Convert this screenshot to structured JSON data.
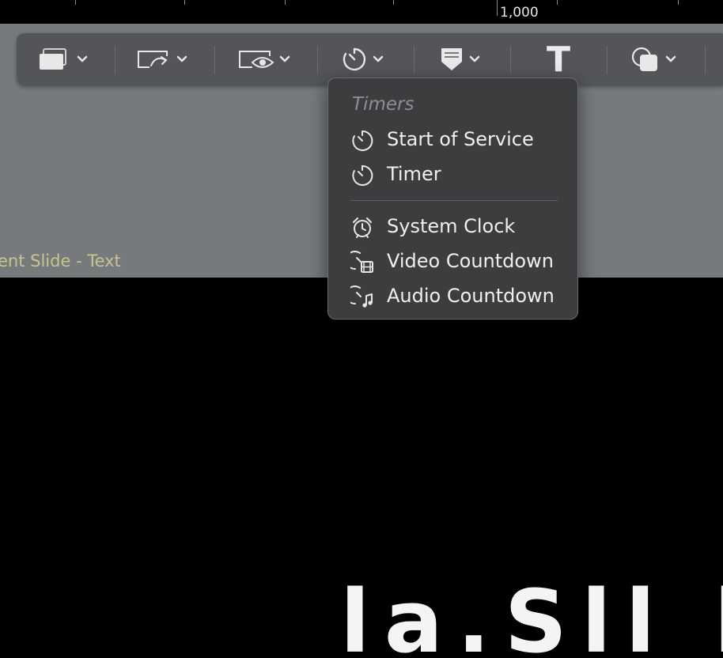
{
  "ruler": {
    "label": "1,000"
  },
  "toolbar": {
    "items": [
      {
        "icon": "slide-layers-icon"
      },
      {
        "icon": "transition-icon"
      },
      {
        "icon": "visibility-icon"
      },
      {
        "icon": "timer-icon"
      },
      {
        "icon": "props-icon"
      },
      {
        "icon": "text-icon",
        "glyph": "T"
      },
      {
        "icon": "shapes-icon"
      }
    ]
  },
  "timers_menu": {
    "header": "Timers",
    "items": [
      {
        "label": "Start of Service",
        "icon": "timer-icon"
      },
      {
        "label": "Timer",
        "icon": "timer-icon"
      },
      {
        "label": "System Clock",
        "icon": "alarm-clock-icon"
      },
      {
        "label": "Video Countdown",
        "icon": "video-countdown-icon"
      },
      {
        "label": "Audio Countdown",
        "icon": "audio-countdown-icon"
      }
    ]
  },
  "canvas": {
    "slide_label": "ent Slide - Text",
    "big_text": "la.Sll l"
  },
  "colors": {
    "toolbar_bg": "#535558",
    "canvas_bg": "#777a7d",
    "menu_bg": "#3c3d3f",
    "slide_label": "#c9c48e"
  }
}
